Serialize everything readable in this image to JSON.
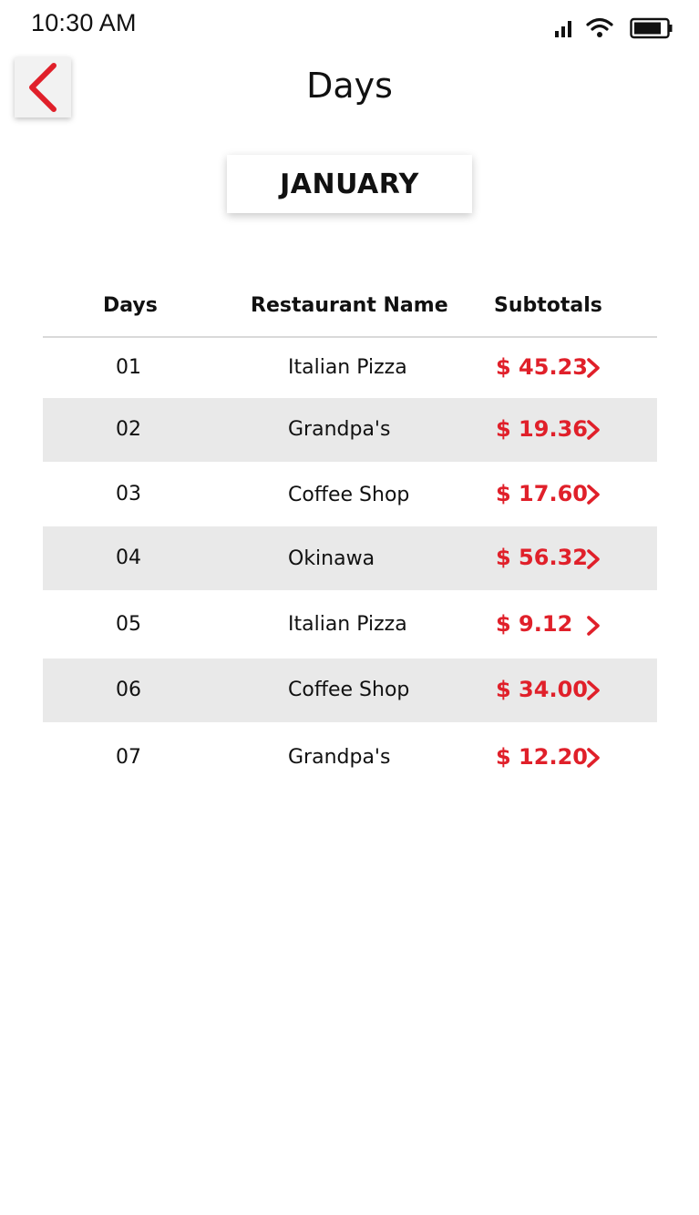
{
  "status_bar": {
    "time": "10:30 AM",
    "icons": [
      "signal-icon",
      "wifi-icon",
      "battery-icon"
    ]
  },
  "header": {
    "back_icon": "chevron-left-icon",
    "title": "Days"
  },
  "month": {
    "label": "JANUARY"
  },
  "table": {
    "columns": [
      "Days",
      "Restaurant Name",
      "Subtotals"
    ],
    "rows": [
      {
        "day": "01",
        "restaurant": "Italian Pizza",
        "subtotal": "$ 45.23"
      },
      {
        "day": "02",
        "restaurant": "Grandpa's",
        "subtotal": "$ 19.36"
      },
      {
        "day": "03",
        "restaurant": "Coffee Shop",
        "subtotal": "$ 17.60"
      },
      {
        "day": "04",
        "restaurant": "Okinawa",
        "subtotal": "$ 56.32"
      },
      {
        "day": "05",
        "restaurant": "Italian Pizza",
        "subtotal": "$ 9.12"
      },
      {
        "day": "06",
        "restaurant": "Coffee Shop",
        "subtotal": "$ 34.00"
      },
      {
        "day": "07",
        "restaurant": "Grandpa's",
        "subtotal": "$ 12.20"
      }
    ],
    "row_icon": "chevron-right-icon"
  },
  "colors": {
    "accent": "#e0202a",
    "row_shade": "#e9e9e9",
    "text": "#111111"
  }
}
